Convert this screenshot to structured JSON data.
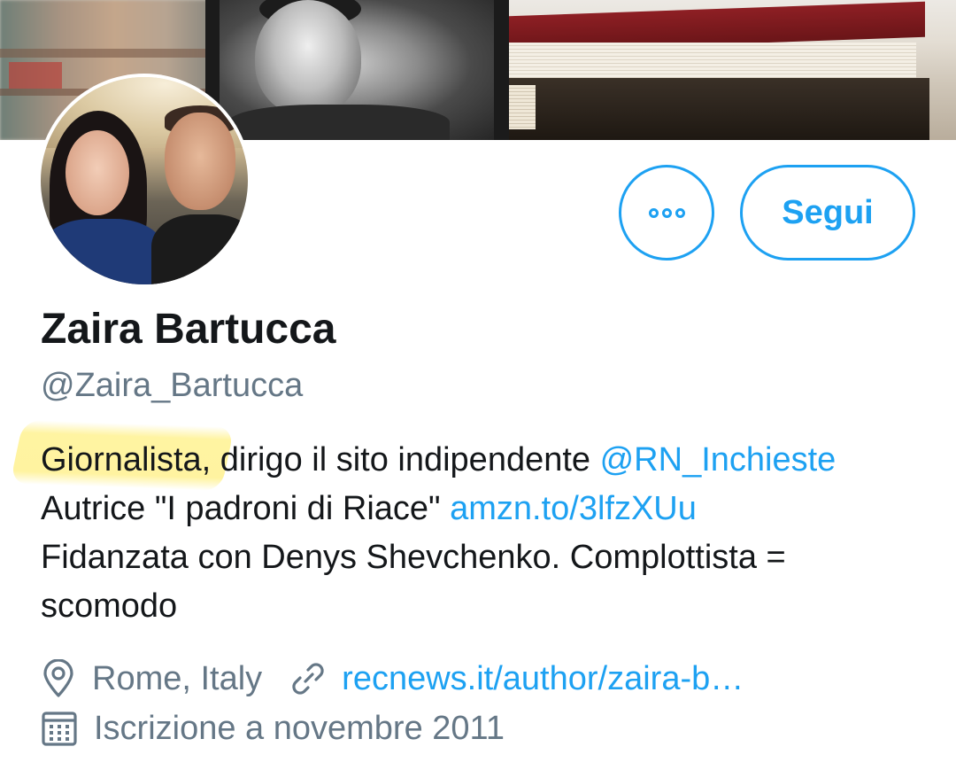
{
  "profile": {
    "name": "Zaira Bartucca",
    "handle": "@Zaira_Bartucca",
    "bio": {
      "l1_a": "Giornalista,",
      "l1_b": " dirigo il sito indipendente ",
      "l1_link": "@RN_Inchieste",
      "l2_a": "Autrice \"I padroni di Riace\" ",
      "l2_link": "amzn.to/3lfzXUu",
      "l3": "Fidanzata con Denys Shevchenko. Complottista =",
      "l4": "scomodo"
    },
    "location": "Rome, Italy",
    "website": "recnews.it/author/zaira-b…",
    "joined": "Iscrizione a novembre 2011"
  },
  "actions": {
    "follow_label": "Segui",
    "more_icon": "more-dots-icon"
  },
  "icons": {
    "location": "map-pin-icon",
    "website": "link-icon",
    "joined": "calendar-icon"
  },
  "colors": {
    "accent": "#1da1f2",
    "text": "#14171a",
    "secondary": "#657786",
    "highlight": "#fff08a"
  }
}
